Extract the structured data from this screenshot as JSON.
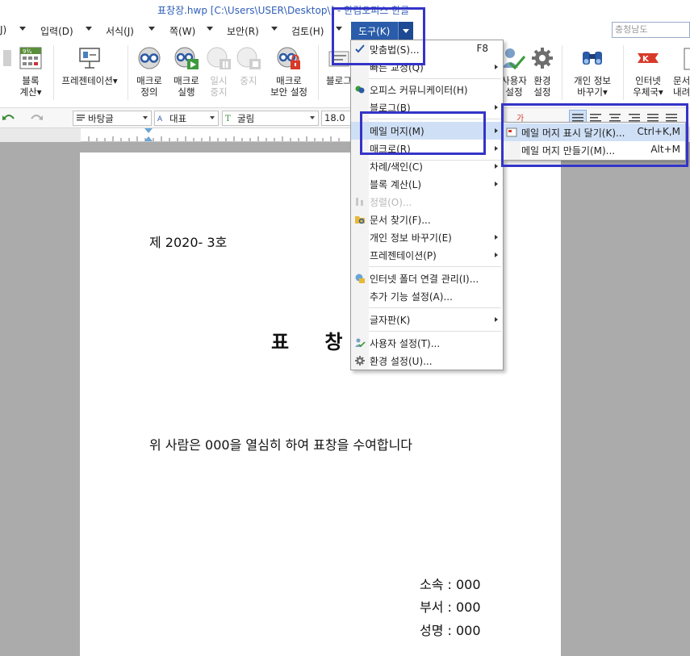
{
  "window": {
    "title": "표창장.hwp [C:\\Users\\USER\\Desktop\\] - 한컴오피스 한글"
  },
  "menubar": {
    "items": [
      "J)",
      "입력(D)",
      "서식(J)",
      "쪽(W)",
      "보안(R)",
      "검토(H)"
    ],
    "tools_label": "도구(K)",
    "search_value": "충청남도"
  },
  "ribbon": {
    "block_calc": "블록\n계산▾",
    "presentation": "프레젠테이션▾",
    "macro_define": "매크로\n정의",
    "macro_run": "매크로\n실행",
    "macro_pause": "일시\n중지",
    "macro_stop": "중지",
    "macro_security": "매크로\n보안 설정",
    "block_partial": "블로그",
    "user_settings": "사용자\n설정",
    "env_settings": "환경\n설정",
    "privacy_change": "개인 정보\n바꾸기▾",
    "internet_post": "인터넷\n우체국▾",
    "doc_partial": "문서\n내려"
  },
  "formatbar": {
    "style": "바탕글",
    "lang": "대표",
    "font": "굴림",
    "size": "18.0"
  },
  "document": {
    "number_line": "제 2020- 3호",
    "title": "표 창 장",
    "body": "위 사람은 000을 열심히 하여 표창을 수여합니다",
    "affiliation": "소속 : 000",
    "department": "부서 : 000",
    "name": "성명 : 000"
  },
  "tools_menu": {
    "items": [
      {
        "label": "맞춤법(S)...",
        "shortcut": "F8"
      },
      {
        "label": "빠른 교정(Q)"
      },
      {
        "label": "오피스 커뮤니케이터(H)"
      },
      {
        "label": "블로그(B)"
      },
      {
        "label": "메일 머지(M)"
      },
      {
        "label": "매크로(R)"
      },
      {
        "label": "차례/색인(C)"
      },
      {
        "label": "블록 계산(L)"
      },
      {
        "label": "정렬(O)..."
      },
      {
        "label": "문서 찾기(F)..."
      },
      {
        "label": "개인 정보 바꾸기(E)"
      },
      {
        "label": "프레젠테이션(P)"
      },
      {
        "label": "인터넷 폴더 연결 관리(I)..."
      },
      {
        "label": "추가 기능 설정(A)..."
      },
      {
        "label": "글자판(K)"
      },
      {
        "label": "사용자 설정(T)..."
      },
      {
        "label": "환경 설정(U)..."
      }
    ]
  },
  "mailmerge_submenu": {
    "items": [
      {
        "label": "메일 머지 표시 달기(K)...",
        "shortcut": "Ctrl+K,M"
      },
      {
        "label": "메일 머지 만들기(M)...",
        "shortcut": "Alt+M"
      }
    ]
  },
  "colors": {
    "accent": "#2a5caa",
    "annotation": "#3434c8",
    "highlight": "#cfe0f6"
  }
}
